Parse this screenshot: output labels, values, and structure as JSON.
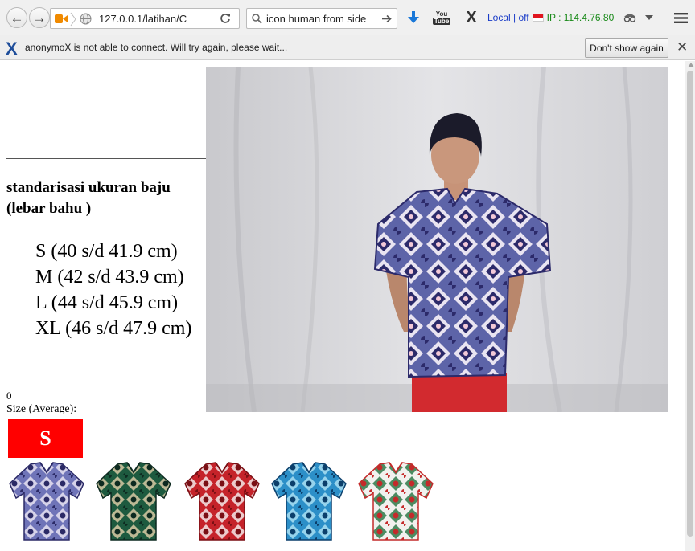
{
  "browser": {
    "url": "127.0.0.1/latihan/C",
    "search_query": "icon human from side",
    "proxy_status": "Local | off",
    "ip_label": "IP :",
    "ip_value": "114.4.76.80"
  },
  "notification": {
    "message": "anonymoX is not able to connect. Will try again, please wait...",
    "dismiss_label": "Don't show again"
  },
  "page": {
    "heading": "standarisasi ukuran baju (lebar bahu )",
    "sizes": [
      "S (40 s/d 41.9 cm)",
      "M (42 s/d 43.9 cm)",
      "L (44 s/d 45.9 cm)",
      "XL (46 s/d 47.9 cm)"
    ],
    "counter": "0",
    "size_label": "Size (Average):",
    "size_value": "S",
    "size_color": "#ff0000"
  },
  "shirts": [
    {
      "name": "shirt-blue-batik",
      "base": "#6f74b8",
      "accent": "#2b2a66",
      "pattern": "#e6e3f2"
    },
    {
      "name": "shirt-green-batik",
      "base": "#1d5a3f",
      "accent": "#0d2a20",
      "pattern": "#d7c9a3"
    },
    {
      "name": "shirt-red-batik",
      "base": "#c5232a",
      "accent": "#7a0f14",
      "pattern": "#f4e8e8"
    },
    {
      "name": "shirt-turquoise-batik",
      "base": "#2c8fc8",
      "accent": "#0c3f6b",
      "pattern": "#a8e0f2"
    },
    {
      "name": "shirt-white-floral-batik",
      "base": "#f1f1ee",
      "accent": "#c42a2a",
      "pattern": "#2f7a4a"
    }
  ]
}
